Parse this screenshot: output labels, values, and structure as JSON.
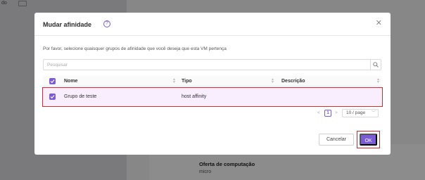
{
  "background": {
    "top_left_text": "do",
    "offer_label": "Oferta de computação",
    "offer_value": "micro"
  },
  "modal": {
    "title": "Mudar afinidade",
    "help_icon": "help-circle-icon",
    "close_icon": "close-icon",
    "description": "Por favor, selecione quaisquer grupos de afinidade que você deseja que esta VM pertença",
    "search": {
      "placeholder": "Pesquisar",
      "value": ""
    },
    "table": {
      "columns": [
        "Nome",
        "Tipo",
        "Descrição"
      ],
      "rows": [
        {
          "checked": true,
          "nome": "Grupo de teste",
          "tipo": "host affinity",
          "descricao": ""
        }
      ]
    },
    "pagination": {
      "prev": "<",
      "page": "1",
      "next": ">",
      "page_size": "10 / page"
    },
    "buttons": {
      "cancel": "Cancelar",
      "ok": "OK"
    }
  },
  "colors": {
    "accent": "#7b5bd6",
    "highlight_border": "#e0262b",
    "row_selected": "#f8eefe"
  }
}
